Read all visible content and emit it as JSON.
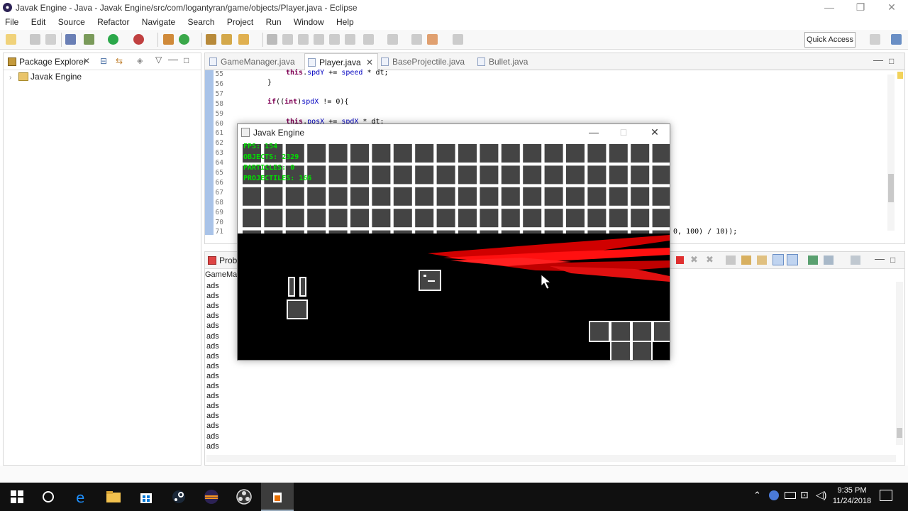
{
  "window": {
    "title": "Javak Engine - Java - Javak Engine/src/com/logantyran/game/objects/Player.java - Eclipse"
  },
  "menu": [
    "File",
    "Edit",
    "Source",
    "Refactor",
    "Navigate",
    "Search",
    "Project",
    "Run",
    "Window",
    "Help"
  ],
  "toolbar": {
    "quick_access": "Quick Access"
  },
  "package_explorer": {
    "title": "Package Explorer",
    "project": "Javak Engine"
  },
  "editor": {
    "tabs": [
      "GameManager.java",
      "Player.java",
      "BaseProjectile.java",
      "Bullet.java"
    ],
    "active_tab": "Player.java",
    "line_numbers": [
      "55",
      "56",
      "57",
      "58",
      "59",
      "60",
      "61",
      "62",
      "63",
      "64",
      "65",
      "66",
      "67",
      "68",
      "69",
      "70",
      "71"
    ],
    "lines": {
      "l55": "this.spdY += speed * dt;",
      "l56": "}",
      "l58": "if((int)spdX != 0){",
      "l60": "this.posX += spdX * dt;",
      "l71": "0, 100) / 10));"
    }
  },
  "console": {
    "tab_partial": "Probl",
    "header_partial": "GameMa",
    "lines": [
      "ads",
      "ads",
      "ads",
      "ads",
      "ads",
      "ads",
      "ads",
      "ads",
      "ads",
      "ads",
      "ads",
      "ads",
      "ads",
      "ads",
      "ads",
      "ads",
      "ads"
    ]
  },
  "game_window": {
    "title": "Javak Engine",
    "hud": {
      "fps": "FPS: 154",
      "objects": "OBJECTS: 2329",
      "particles": "PARTICLES: 0",
      "projectiles": "PROJECTILES: 166"
    }
  },
  "taskbar": {
    "time": "9:35 PM",
    "date": "11/24/2018"
  },
  "colors": {
    "hud_green": "#00e000",
    "projectile_red": "#e00000",
    "gutter_blue": "#a9c3e8"
  }
}
